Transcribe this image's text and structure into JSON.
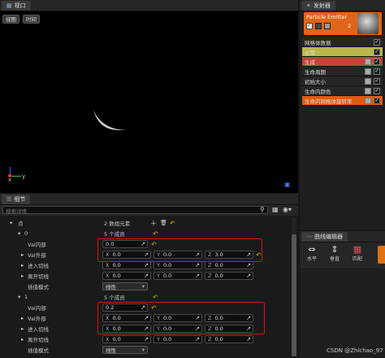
{
  "viewport": {
    "tab_label": "视口",
    "btn_view": "视图",
    "btn_time": "时间",
    "axis_x": "x",
    "axis_y": "y"
  },
  "emitters": {
    "tab_label": "发射器",
    "card_title": "Particle Emitter",
    "card_count": "2",
    "modules": [
      {
        "label": "网格体数据",
        "color": "#262626",
        "checks": 1
      },
      {
        "label": "必需",
        "color": "#b9b84a",
        "checks": 1
      },
      {
        "label": "生成",
        "color": "#c0463a",
        "checks": 2
      },
      {
        "label": "生命周期",
        "color": "#262626",
        "checks": 2
      },
      {
        "label": "初始大小",
        "color": "#262626",
        "checks": 2
      },
      {
        "label": "生命内颜色",
        "color": "#262626",
        "checks": 2
      },
      {
        "label": "生命内网格体旋转率",
        "color": "#e05a10",
        "checks": 2
      }
    ]
  },
  "details": {
    "tab_label": "细节",
    "search_placeholder": "搜索详情",
    "rows": {
      "points_label": "点",
      "points_count": "2 数组元素",
      "item0_label": "0",
      "item0_count": "5 个成员",
      "valin0_label": "Val内部",
      "valin0_value": "0.0",
      "valout0_label": "Val外部",
      "valout0_x": "0.0",
      "valout0_y": "0.0",
      "valout0_z": "3.0",
      "arrivein0_label": "进入切线",
      "arrivein0_x": "0.0",
      "arrivein0_y": "0.0",
      "arrivein0_z": "0.0",
      "leaveout0_label": "离开切线",
      "leaveout0_x": "0.0",
      "leaveout0_y": "0.0",
      "leaveout0_z": "0.0",
      "interp0_label": "插值模式",
      "interp0_value": "线性",
      "item1_label": "1",
      "item1_count": "5 个成员",
      "valin1_label": "Val内部",
      "valin1_value": "0.2",
      "valout1_label": "Val外部",
      "valout1_x": "0.0",
      "valout1_y": "0.0",
      "valout1_z": "0.0",
      "arrivein1_label": "进入切线",
      "arrivein1_x": "0.0",
      "arrivein1_y": "0.0",
      "arrivein1_z": "0.0",
      "leaveout1_label": "离开切线",
      "leaveout1_x": "0.0",
      "leaveout1_y": "0.0",
      "leaveout1_z": "0.0",
      "interp1_label": "插值模式",
      "interp1_value": "线性"
    }
  },
  "curve_editor": {
    "tab_label": "曲线编辑器",
    "btn_horizontal": "水平",
    "btn_vertical": "垂直",
    "btn_fit": "匹配"
  },
  "watermark": "CSDN @Zhichao_97"
}
